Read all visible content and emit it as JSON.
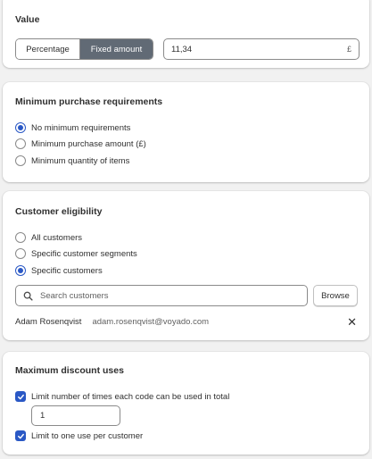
{
  "value_section": {
    "title": "Value",
    "type_options": [
      "Percentage",
      "Fixed amount"
    ],
    "selected_type": "Fixed amount",
    "amount": "11,34",
    "currency_suffix": "£"
  },
  "min_purchase": {
    "title": "Minimum purchase requirements",
    "options": [
      {
        "label": "No minimum requirements",
        "selected": true
      },
      {
        "label": "Minimum purchase amount (£)",
        "selected": false
      },
      {
        "label": "Minimum quantity of items",
        "selected": false
      }
    ]
  },
  "eligibility": {
    "title": "Customer eligibility",
    "options": [
      {
        "label": "All customers",
        "selected": false
      },
      {
        "label": "Specific customer segments",
        "selected": false
      },
      {
        "label": "Specific customers",
        "selected": true
      }
    ],
    "search_placeholder": "Search customers",
    "browse_label": "Browse",
    "selected_customers": [
      {
        "name": "Adam Rosenqvist",
        "email": "adam.rosenqvist@voyado.com",
        "remove_icon": "close-icon"
      }
    ]
  },
  "max_uses": {
    "title": "Maximum discount uses",
    "limit_total_label": "Limit number of times each code can be used in total",
    "limit_total_checked": true,
    "limit_total_value": "1",
    "one_per_customer_label": "Limit to one use per customer",
    "one_per_customer_checked": true
  },
  "colors": {
    "accent": "#2a58c5",
    "segment_selected_bg": "#616a75",
    "page_bg": "#f1f1f1"
  }
}
